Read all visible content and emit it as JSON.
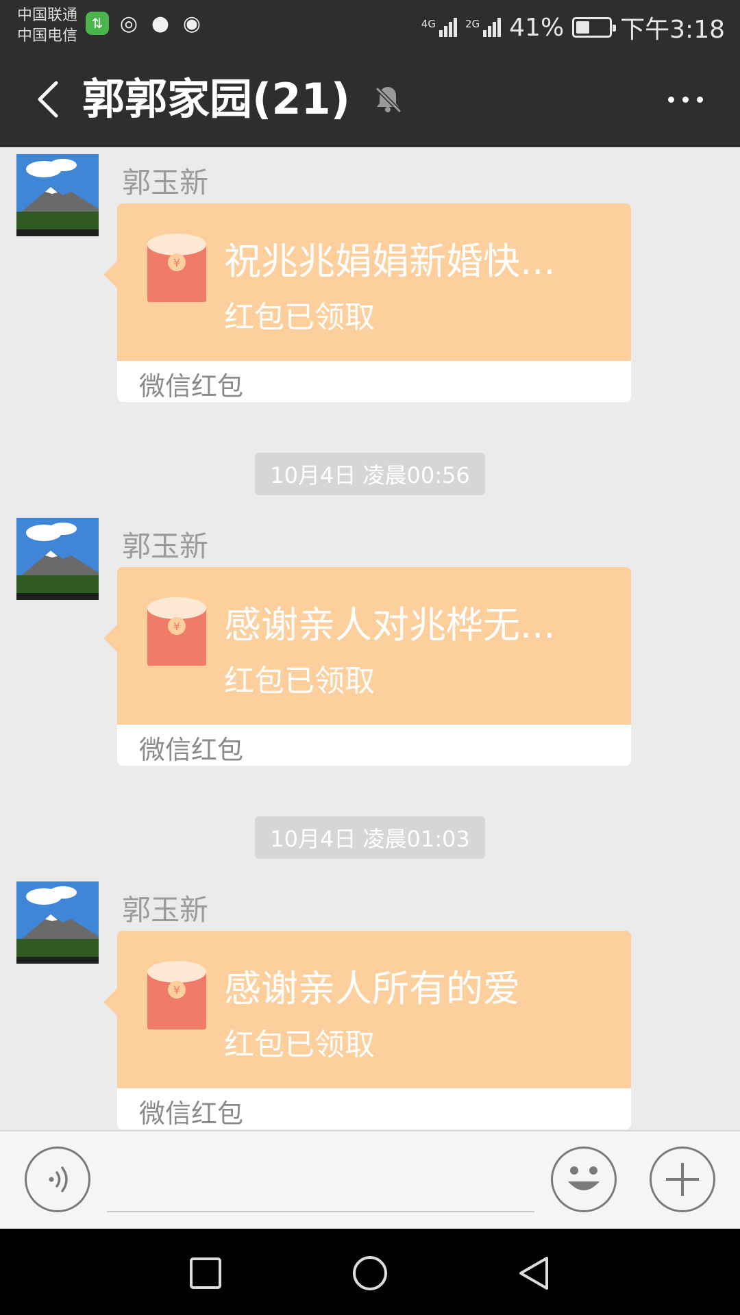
{
  "status_bar": {
    "carrier_1": "中国联通",
    "carrier_2": "中国电信",
    "net_1": "4G",
    "net_2": "2G",
    "battery": "41%",
    "battery_level": 0.41,
    "time": "下午3:18",
    "app_icons": [
      "sync-icon",
      "camera-lens-icon",
      "chat-bubble-icon",
      "browser-icon"
    ]
  },
  "header": {
    "title": "郭郭家园(21)",
    "muted": true
  },
  "messages": [
    {
      "sender": "郭玉新",
      "greeting": "祝兆兆娟娟新婚快...",
      "status": "红包已领取",
      "brand": "微信红包"
    },
    {
      "timestamp": "10月4日 凌晨00:56",
      "sender": "郭玉新",
      "greeting": "感谢亲人对兆桦无...",
      "status": "红包已领取",
      "brand": "微信红包"
    },
    {
      "timestamp": "10月4日 凌晨01:03",
      "sender": "郭玉新",
      "greeting": "感谢亲人所有的爱",
      "status": "红包已领取",
      "brand": "微信红包"
    }
  ],
  "colors": {
    "header_bg": "#2e2e2e",
    "chat_bg": "#ebebeb",
    "packet_orange": "#fccf9c",
    "envelope_red": "#ef7b68"
  }
}
